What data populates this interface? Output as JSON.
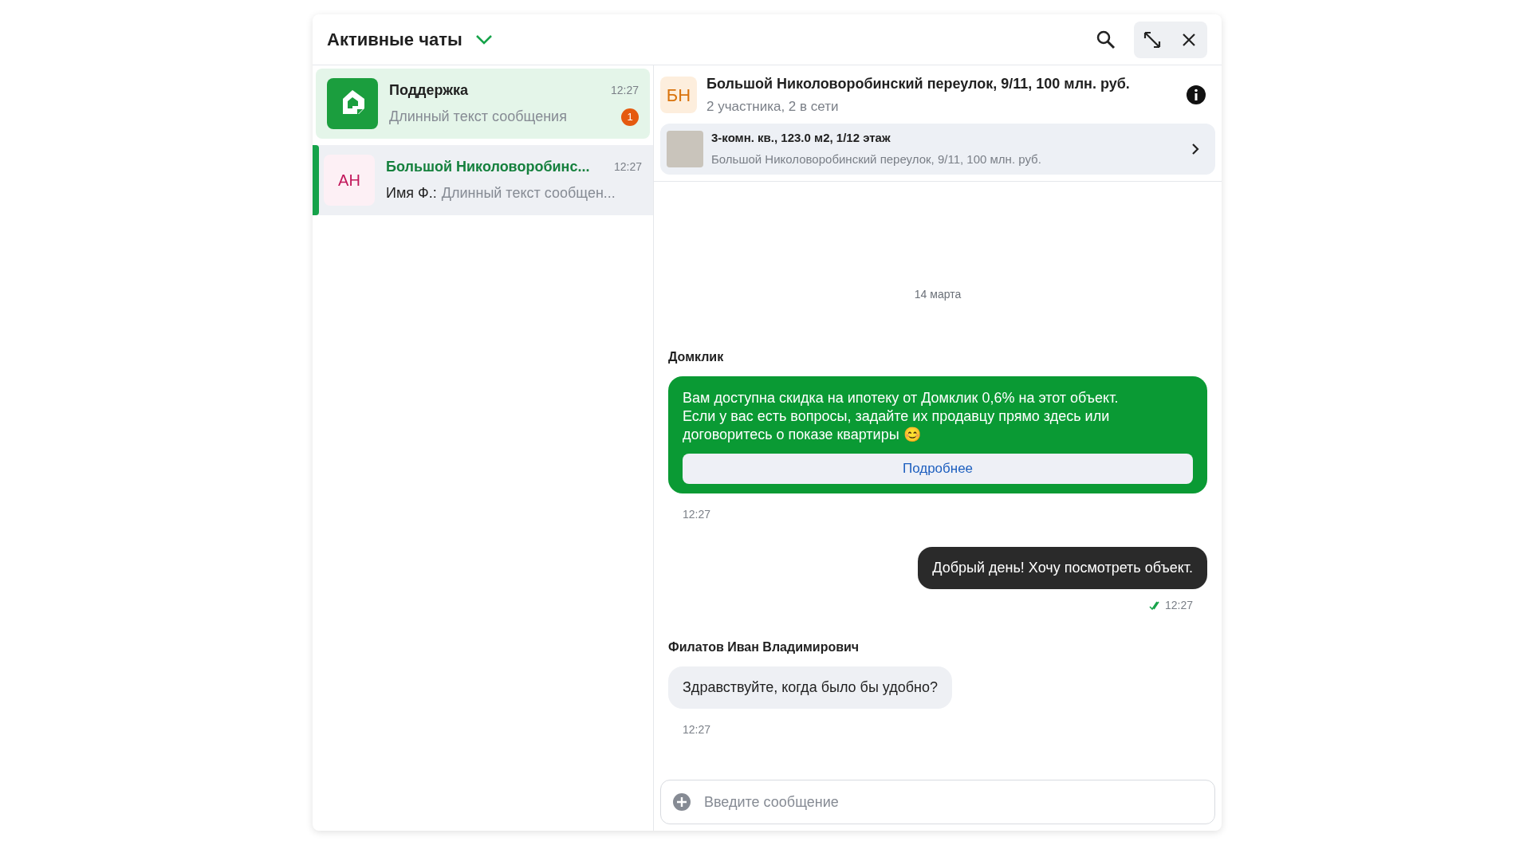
{
  "header": {
    "title": "Активные чаты"
  },
  "chats": [
    {
      "kind": "support",
      "name": "Поддержка",
      "time": "12:27",
      "preview": "Длинный текст сообщения",
      "unread": "1",
      "selected": false
    },
    {
      "kind": "person",
      "initials": "АН",
      "name": "Большой Николоворобинс...",
      "time": "12:27",
      "preview_author": "Имя Ф.:",
      "preview": "Длинный текст сообщен...",
      "selected": true
    }
  ],
  "conversation": {
    "initials": "БН",
    "title": "Большой Николоворобинский переулок, 9/11, 100 млн. руб.",
    "subtitle": "2 участника, 2 в сети",
    "listing": {
      "title": "3-комн. кв., 123.0 м2, 1/12 этаж",
      "address": "Большой Николоворобинский переулок, 9/11, 100 млн. руб."
    },
    "messages": [
      {
        "kind": "date",
        "text": "14 марта"
      },
      {
        "kind": "promo",
        "sender": "Домклик",
        "text": "Вам доступна скидка на ипотеку от Домклик 0,6% на этот объект. Если у вас есть вопросы, задайте их продавцу прямо здесь или договоритесь о показе квартиры 😊",
        "button": "Подробнее",
        "time": "12:27"
      },
      {
        "kind": "outgoing",
        "text": "Добрый день! Хочу посмотреть объект.",
        "read": true,
        "time": "12:27"
      },
      {
        "kind": "incoming",
        "sender": "Филатов Иван Владимирович",
        "text": "Здравствуйте, когда было бы удобно?",
        "time": "12:27"
      }
    ],
    "input": {
      "placeholder": "Введите сообщение"
    }
  }
}
